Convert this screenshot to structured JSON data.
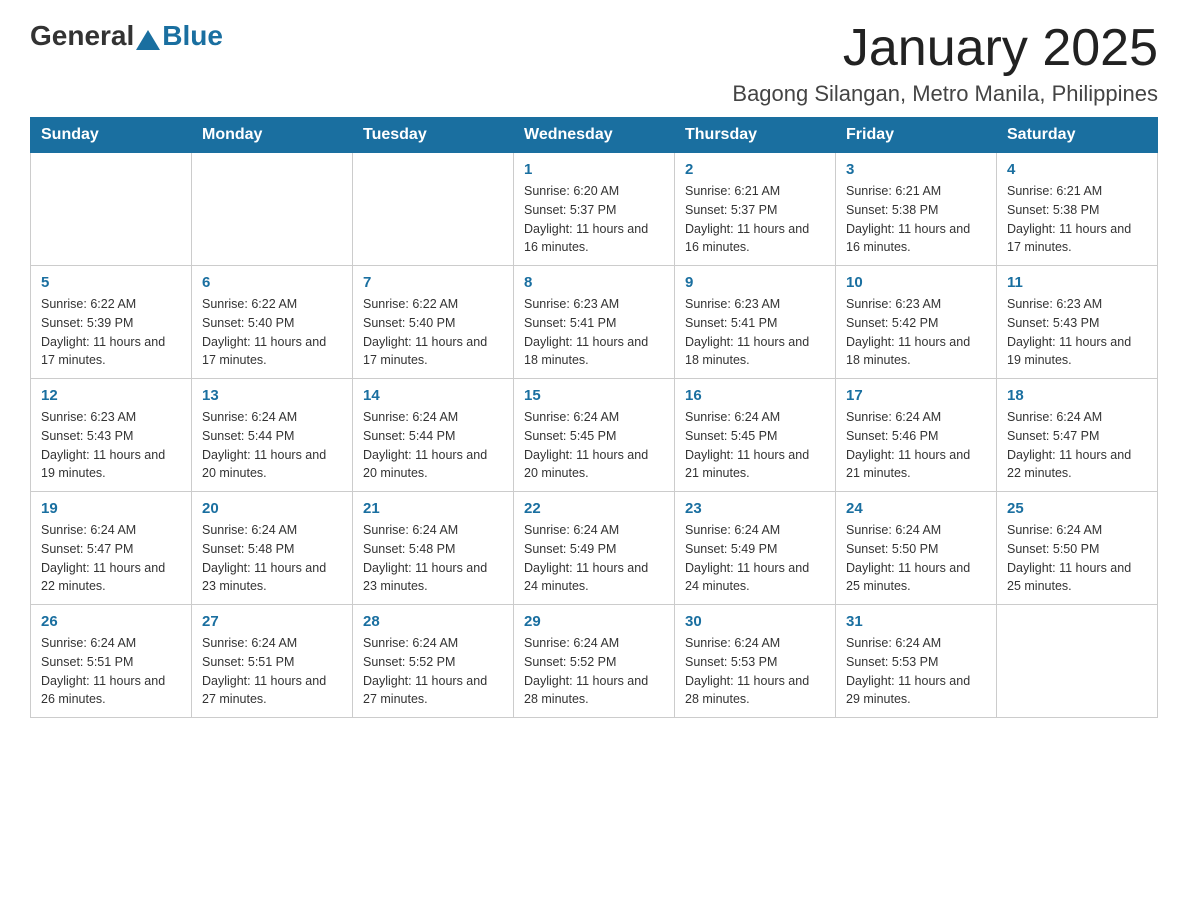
{
  "header": {
    "logo_general": "General",
    "logo_blue": "Blue",
    "month_title": "January 2025",
    "location": "Bagong Silangan, Metro Manila, Philippines"
  },
  "days_of_week": [
    "Sunday",
    "Monday",
    "Tuesday",
    "Wednesday",
    "Thursday",
    "Friday",
    "Saturday"
  ],
  "weeks": [
    [
      {
        "day": "",
        "info": ""
      },
      {
        "day": "",
        "info": ""
      },
      {
        "day": "",
        "info": ""
      },
      {
        "day": "1",
        "info": "Sunrise: 6:20 AM\nSunset: 5:37 PM\nDaylight: 11 hours and 16 minutes."
      },
      {
        "day": "2",
        "info": "Sunrise: 6:21 AM\nSunset: 5:37 PM\nDaylight: 11 hours and 16 minutes."
      },
      {
        "day": "3",
        "info": "Sunrise: 6:21 AM\nSunset: 5:38 PM\nDaylight: 11 hours and 16 minutes."
      },
      {
        "day": "4",
        "info": "Sunrise: 6:21 AM\nSunset: 5:38 PM\nDaylight: 11 hours and 17 minutes."
      }
    ],
    [
      {
        "day": "5",
        "info": "Sunrise: 6:22 AM\nSunset: 5:39 PM\nDaylight: 11 hours and 17 minutes."
      },
      {
        "day": "6",
        "info": "Sunrise: 6:22 AM\nSunset: 5:40 PM\nDaylight: 11 hours and 17 minutes."
      },
      {
        "day": "7",
        "info": "Sunrise: 6:22 AM\nSunset: 5:40 PM\nDaylight: 11 hours and 17 minutes."
      },
      {
        "day": "8",
        "info": "Sunrise: 6:23 AM\nSunset: 5:41 PM\nDaylight: 11 hours and 18 minutes."
      },
      {
        "day": "9",
        "info": "Sunrise: 6:23 AM\nSunset: 5:41 PM\nDaylight: 11 hours and 18 minutes."
      },
      {
        "day": "10",
        "info": "Sunrise: 6:23 AM\nSunset: 5:42 PM\nDaylight: 11 hours and 18 minutes."
      },
      {
        "day": "11",
        "info": "Sunrise: 6:23 AM\nSunset: 5:43 PM\nDaylight: 11 hours and 19 minutes."
      }
    ],
    [
      {
        "day": "12",
        "info": "Sunrise: 6:23 AM\nSunset: 5:43 PM\nDaylight: 11 hours and 19 minutes."
      },
      {
        "day": "13",
        "info": "Sunrise: 6:24 AM\nSunset: 5:44 PM\nDaylight: 11 hours and 20 minutes."
      },
      {
        "day": "14",
        "info": "Sunrise: 6:24 AM\nSunset: 5:44 PM\nDaylight: 11 hours and 20 minutes."
      },
      {
        "day": "15",
        "info": "Sunrise: 6:24 AM\nSunset: 5:45 PM\nDaylight: 11 hours and 20 minutes."
      },
      {
        "day": "16",
        "info": "Sunrise: 6:24 AM\nSunset: 5:45 PM\nDaylight: 11 hours and 21 minutes."
      },
      {
        "day": "17",
        "info": "Sunrise: 6:24 AM\nSunset: 5:46 PM\nDaylight: 11 hours and 21 minutes."
      },
      {
        "day": "18",
        "info": "Sunrise: 6:24 AM\nSunset: 5:47 PM\nDaylight: 11 hours and 22 minutes."
      }
    ],
    [
      {
        "day": "19",
        "info": "Sunrise: 6:24 AM\nSunset: 5:47 PM\nDaylight: 11 hours and 22 minutes."
      },
      {
        "day": "20",
        "info": "Sunrise: 6:24 AM\nSunset: 5:48 PM\nDaylight: 11 hours and 23 minutes."
      },
      {
        "day": "21",
        "info": "Sunrise: 6:24 AM\nSunset: 5:48 PM\nDaylight: 11 hours and 23 minutes."
      },
      {
        "day": "22",
        "info": "Sunrise: 6:24 AM\nSunset: 5:49 PM\nDaylight: 11 hours and 24 minutes."
      },
      {
        "day": "23",
        "info": "Sunrise: 6:24 AM\nSunset: 5:49 PM\nDaylight: 11 hours and 24 minutes."
      },
      {
        "day": "24",
        "info": "Sunrise: 6:24 AM\nSunset: 5:50 PM\nDaylight: 11 hours and 25 minutes."
      },
      {
        "day": "25",
        "info": "Sunrise: 6:24 AM\nSunset: 5:50 PM\nDaylight: 11 hours and 25 minutes."
      }
    ],
    [
      {
        "day": "26",
        "info": "Sunrise: 6:24 AM\nSunset: 5:51 PM\nDaylight: 11 hours and 26 minutes."
      },
      {
        "day": "27",
        "info": "Sunrise: 6:24 AM\nSunset: 5:51 PM\nDaylight: 11 hours and 27 minutes."
      },
      {
        "day": "28",
        "info": "Sunrise: 6:24 AM\nSunset: 5:52 PM\nDaylight: 11 hours and 27 minutes."
      },
      {
        "day": "29",
        "info": "Sunrise: 6:24 AM\nSunset: 5:52 PM\nDaylight: 11 hours and 28 minutes."
      },
      {
        "day": "30",
        "info": "Sunrise: 6:24 AM\nSunset: 5:53 PM\nDaylight: 11 hours and 28 minutes."
      },
      {
        "day": "31",
        "info": "Sunrise: 6:24 AM\nSunset: 5:53 PM\nDaylight: 11 hours and 29 minutes."
      },
      {
        "day": "",
        "info": ""
      }
    ]
  ]
}
